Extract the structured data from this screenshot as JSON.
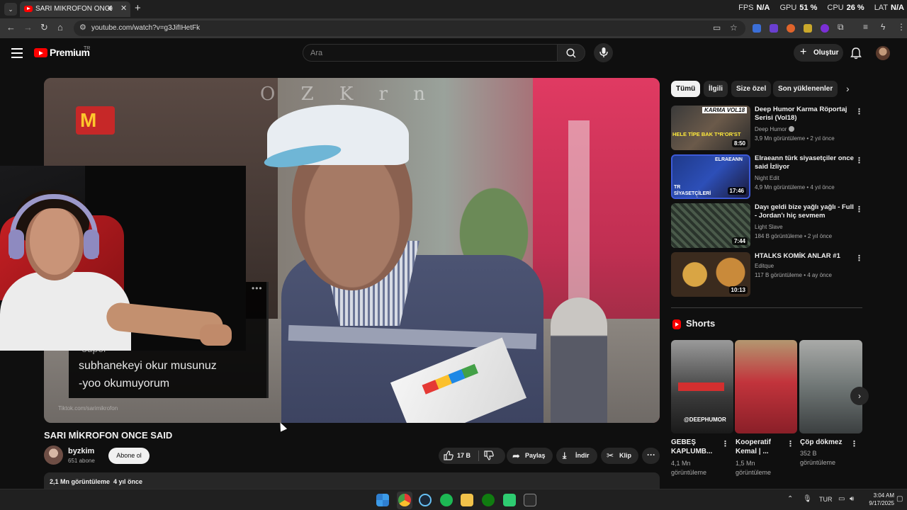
{
  "browser": {
    "tab_title": "SARI MİKROFON ONCE SAID",
    "url": "youtube.com/watch?v=g3JifIHetFk",
    "stats": [
      {
        "label": "FPS",
        "value": "N/A"
      },
      {
        "label": "GPU",
        "value": "51 %"
      },
      {
        "label": "CPU",
        "value": "26 %"
      },
      {
        "label": "LAT",
        "value": "N/A"
      }
    ]
  },
  "header": {
    "logo_text": "Premium",
    "logo_region": "TR",
    "search_placeholder": "Ara",
    "create_label": "Oluştur"
  },
  "video": {
    "banner_text": "O Z K r n",
    "subtitles": [
      "-süper",
      "subhanekeyi okur musunuz",
      "-yoo okumuyorum"
    ],
    "watermark": "Tiktok.com/sarimikrofon"
  },
  "below": {
    "title": "SARI MİKROFON ONCE SAID",
    "channel_name": "byzkim",
    "channel_subs": "651 abone",
    "subscribe_label": "Abone ol",
    "likes": "17 B",
    "share_label": "Paylaş",
    "download_label": "İndir",
    "clip_label": "Klip",
    "views": "2,1 Mn görüntüleme",
    "age": "4 yıl önce"
  },
  "chips": [
    "Tümü",
    "İlgili",
    "Size özel",
    "Son yüklenenler"
  ],
  "recommendations": [
    {
      "title": "Deep Humor Karma Röportaj Serisi (Vol18)",
      "channel": "Deep Humor",
      "meta": "3,9 Mn görüntüleme • 2 yıl önce",
      "duration": "8:50",
      "thumb_text": "HELE TİPE BAK T*R'OR'ST",
      "thumb_top": "KARMA VOL18"
    },
    {
      "title": "Elraeann türk siyasetçiler once said İzliyor",
      "channel": "Night Edit",
      "meta": "4,9 Mn görüntüleme • 4 yıl önce",
      "duration": "17:46",
      "thumb_text": "TR SİYASETÇİLERİ ONCE SAİD",
      "thumb_top": "ELRAEANN"
    },
    {
      "title": "Dayı geldi bize yağlı yağlı - Full - Jordan'ı hiç sevmem",
      "channel": "Light Slave",
      "meta": "184 B görüntüleme • 2 yıl önce",
      "duration": "7:44"
    },
    {
      "title": "HTALKS KOMİK ANLAR #1",
      "channel": "Editque",
      "meta": "117 B görüntüleme • 4 ay önce",
      "duration": "10:13"
    }
  ],
  "shorts": {
    "section_title": "Shorts",
    "items": [
      {
        "title": "GEBEŞ KAPLUMB...",
        "views": "4,1 Mn görüntüleme",
        "caption": "@DEEPHUMOR"
      },
      {
        "title": "Kooperatif Kemal | ...",
        "views": "1,5 Mn görüntüleme"
      },
      {
        "title": "Çöp dökmez",
        "views": "352 B görüntüleme"
      }
    ]
  },
  "taskbar": {
    "lang": "TUR",
    "time": "3:04 AM",
    "date": "9/17/2025"
  }
}
